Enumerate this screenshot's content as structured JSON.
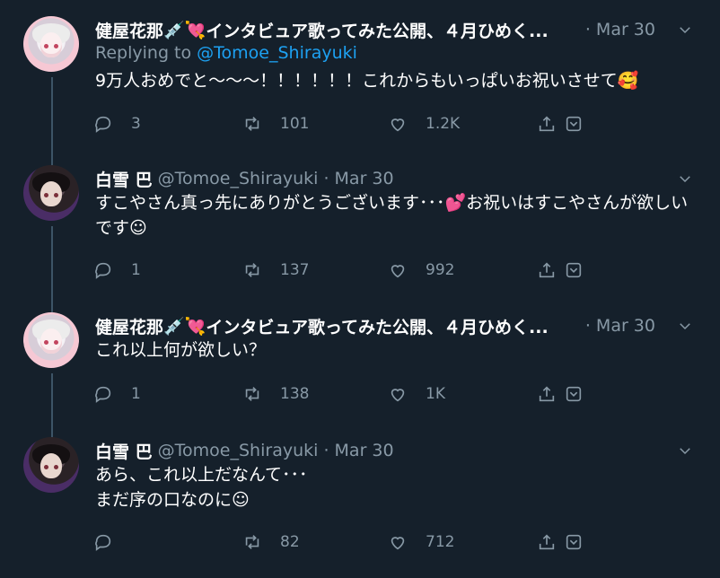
{
  "tweets": [
    {
      "author": "健屋花那",
      "header_rest": "インタビュア歌ってみた公開、４月ひめく...",
      "date": "· Mar 30",
      "reply_prefix": "Replying to",
      "reply_to": "@Tomoe_Shirayuki",
      "text": "9万人おめでと～～～！！！！！！これからもいっぱいお祝いさせて🥰",
      "reply_count": "3",
      "retweet_count": "101",
      "like_count": "1.2K"
    },
    {
      "author": "白雪 巴",
      "handle": "@Tomoe_Shirayuki",
      "date": "· Mar 30",
      "text": "すこやさん真っ先にありがとうございます･･･💕お祝いはすこやさんが欲しいです☺",
      "reply_count": "1",
      "retweet_count": "137",
      "like_count": "992"
    },
    {
      "author": "健屋花那",
      "header_rest": "インタビュア歌ってみた公開、４月ひめく...",
      "date": "· Mar 30",
      "text": "これ以上何が欲しい？",
      "reply_count": "1",
      "retweet_count": "138",
      "like_count": "1K"
    },
    {
      "author": "白雪 巴",
      "handle": "@Tomoe_Shirayuki",
      "date": "· Mar 30",
      "text": "あら、これ以上だなんて･･･\nまだ序の口なのに☺",
      "reply_count": "",
      "retweet_count": "82",
      "like_count": "712"
    }
  ],
  "icons": {
    "syringe_emoji": "💉",
    "heart_emoji": "💘",
    "caret": "⌄"
  },
  "colors": {
    "background": "#15202b",
    "muted": "#8899a6",
    "link": "#1da1f2",
    "thread_line": "#3d5466"
  }
}
